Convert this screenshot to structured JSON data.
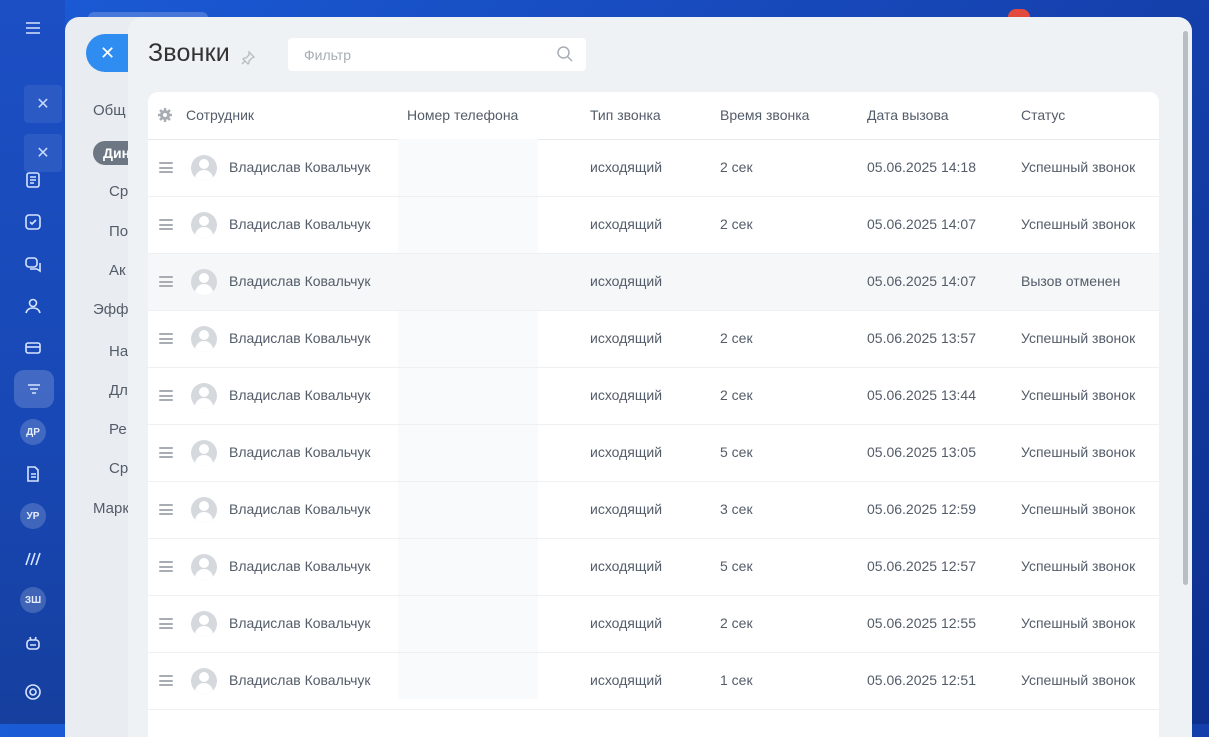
{
  "panel": {
    "title": "Звонки",
    "filter_placeholder": "Фильтр"
  },
  "background": {
    "sidebar_labels": [
      "Общ",
      "Дин",
      "Ср",
      "По",
      "Ак",
      "Эффе",
      "На",
      "Дл",
      "Ре",
      "Ср",
      "Марк"
    ],
    "rail_avatars": [
      "ДР",
      "УР",
      "ЗШ"
    ],
    "notification_badge": "39"
  },
  "table": {
    "columns": [
      "Сотрудник",
      "Номер телефона",
      "Тип звонка",
      "Время звонка",
      "Дата вызова",
      "Статус"
    ],
    "rows": [
      {
        "employee": "Владислав Ковальчук",
        "phone": "",
        "type": "исходящий",
        "duration": "2 сек",
        "date": "05.06.2025 14:18",
        "status": "Успешный звонок"
      },
      {
        "employee": "Владислав Ковальчук",
        "phone": "",
        "type": "исходящий",
        "duration": "2 сек",
        "date": "05.06.2025 14:07",
        "status": "Успешный звонок"
      },
      {
        "employee": "Владислав Ковальчук",
        "phone": "",
        "type": "исходящий",
        "duration": "",
        "date": "05.06.2025 14:07",
        "status": "Вызов отменен"
      },
      {
        "employee": "Владислав Ковальчук",
        "phone": "",
        "type": "исходящий",
        "duration": "2 сек",
        "date": "05.06.2025 13:57",
        "status": "Успешный звонок"
      },
      {
        "employee": "Владислав Ковальчук",
        "phone": "",
        "type": "исходящий",
        "duration": "2 сек",
        "date": "05.06.2025 13:44",
        "status": "Успешный звонок"
      },
      {
        "employee": "Владислав Ковальчук",
        "phone": "",
        "type": "исходящий",
        "duration": "5 сек",
        "date": "05.06.2025 13:05",
        "status": "Успешный звонок"
      },
      {
        "employee": "Владислав Ковальчук",
        "phone": "",
        "type": "исходящий",
        "duration": "3 сек",
        "date": "05.06.2025 12:59",
        "status": "Успешный звонок"
      },
      {
        "employee": "Владислав Ковальчук",
        "phone": "",
        "type": "исходящий",
        "duration": "5 сек",
        "date": "05.06.2025 12:57",
        "status": "Успешный звонок"
      },
      {
        "employee": "Владислав Ковальчук",
        "phone": "",
        "type": "исходящий",
        "duration": "2 сек",
        "date": "05.06.2025 12:55",
        "status": "Успешный звонок"
      },
      {
        "employee": "Владислав Ковальчук",
        "phone": "",
        "type": "исходящий",
        "duration": "1 сек",
        "date": "05.06.2025 12:51",
        "status": "Успешный звонок"
      }
    ]
  }
}
